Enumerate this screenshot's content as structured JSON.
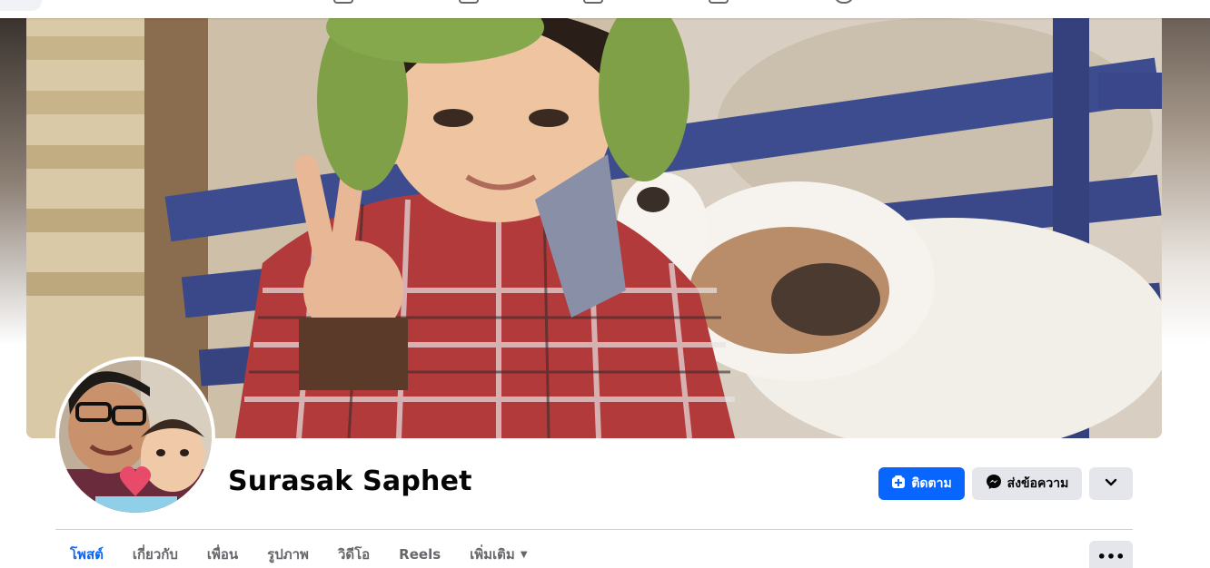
{
  "profile": {
    "name": "Surasak Saphet"
  },
  "actions": {
    "follow_label": "ติดตาม",
    "message_label": "ส่งข้อความ",
    "more_icon": "chevron-down-icon"
  },
  "tabs": [
    {
      "label": "โพสต์",
      "active": true
    },
    {
      "label": "เกี่ยวกับ",
      "active": false
    },
    {
      "label": "เพื่อน",
      "active": false
    },
    {
      "label": "รูปภาพ",
      "active": false
    },
    {
      "label": "วิดีโอ",
      "active": false
    },
    {
      "label": "Reels",
      "active": false
    },
    {
      "label": "เพิ่มเติม",
      "active": false
    }
  ],
  "tab_options_label": "•••",
  "colors": {
    "accent": "#0866ff",
    "button_gray": "#e4e6eb",
    "text_primary": "#050505",
    "text_secondary": "#65676b"
  }
}
